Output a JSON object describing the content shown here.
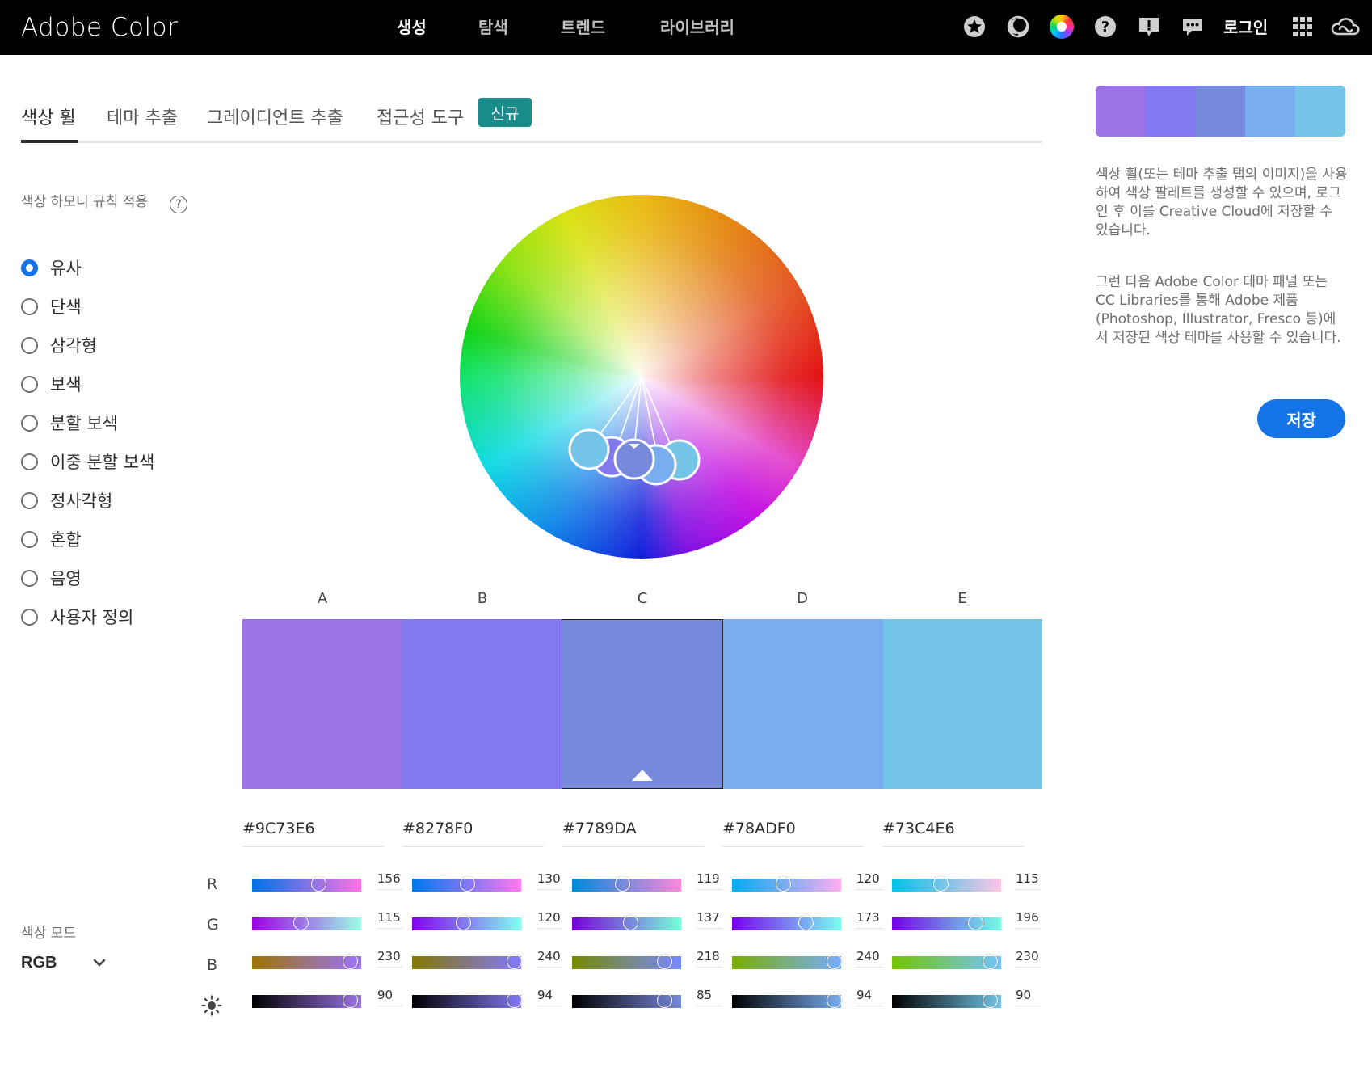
{
  "header": {
    "brand": "Adobe Color",
    "nav": [
      "생성",
      "탐색",
      "트렌드",
      "라이브러리"
    ],
    "active_nav": "생성",
    "login_label": "로그인",
    "icons": [
      "star-icon",
      "contrast-icon",
      "color-wheel-icon",
      "help-icon",
      "feedback-icon",
      "chat-icon",
      "apps-grid-icon",
      "creative-cloud-icon"
    ]
  },
  "tabs": {
    "items": [
      "색상 휠",
      "테마 추출",
      "그레이디언트 추출",
      "접근성 도구"
    ],
    "active": "색상 휠",
    "new_badge": "신규"
  },
  "harmony": {
    "title": "색상 하모니 규칙 적용",
    "help": "?",
    "options": [
      "유사",
      "단색",
      "삼각형",
      "보색",
      "분할 보색",
      "이중 분할 보색",
      "정사각형",
      "혼합",
      "음영",
      "사용자 정의"
    ],
    "selected": "유사"
  },
  "swatches": [
    {
      "letter": "A",
      "hex": "#9C73E6",
      "r": "156",
      "g": "115",
      "b": "230",
      "brightness": "90"
    },
    {
      "letter": "B",
      "hex": "#8278F0",
      "r": "130",
      "g": "120",
      "b": "240",
      "brightness": "94"
    },
    {
      "letter": "C",
      "hex": "#7789DA",
      "r": "119",
      "g": "137",
      "b": "218",
      "brightness": "85"
    },
    {
      "letter": "D",
      "hex": "#78ADF0",
      "r": "120",
      "g": "173",
      "b": "240",
      "brightness": "94"
    },
    {
      "letter": "E",
      "hex": "#73C4E6",
      "r": "115",
      "g": "196",
      "b": "230",
      "brightness": "90"
    }
  ],
  "selected_swatch": "C",
  "channels": {
    "r": "R",
    "g": "G",
    "b": "B",
    "brightness_icon": "sun-icon"
  },
  "color_mode": {
    "title": "색상 모드",
    "value": "RGB"
  },
  "right_panel": {
    "description1": "색상 휠(또는 테마 추출 탭의 이미지)을 사용하여 색상 팔레트를 생성할 수 있으며, 로그인 후 이를 Creative Cloud에 저장할 수 있습니다.",
    "description2": "그런 다음 Adobe Color 테마 패널 또는 CC Libraries를 통해 Adobe 제품(Photoshop, Illustrator, Fresco 등)에서 저장된 색상 테마를 사용할 수 있습니다.",
    "save_label": "저장"
  },
  "colors": {
    "accent": "#1473e6",
    "badge": "#1a8b8b"
  }
}
